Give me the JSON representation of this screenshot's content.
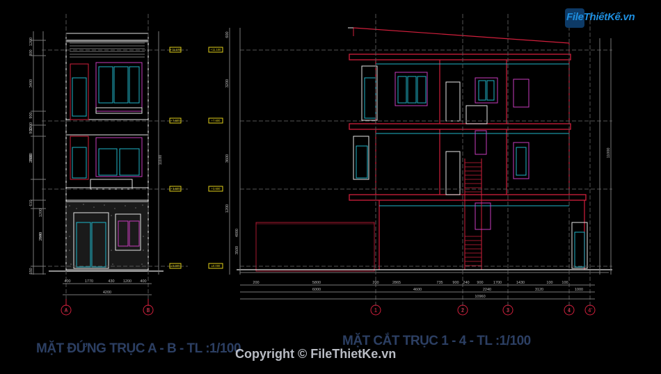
{
  "drawing": {
    "title_left": "MẶT ĐỨNG TRỤC A - B - TL :1/100",
    "title_right": "MẶT CẮT TRỤC 1 - 4 - TL :1/100",
    "copyright": "Copyright © FileThietKe.vn",
    "logo": "FileThiếtKế.vn"
  },
  "left_elevation": {
    "width_dims": [
      "400",
      "1770",
      "430",
      "1200",
      "400"
    ],
    "total_width": "4200",
    "vertical_dims": [
      "1200",
      "800",
      "3400",
      "900",
      "2800",
      "1300",
      "900",
      "2600",
      "610",
      "1200",
      "2800",
      "2940",
      "550"
    ],
    "total_height": "11100",
    "axes": [
      "A",
      "B"
    ],
    "level_marks": [
      "+11.100",
      "+7.600",
      "+3.600",
      "±0.000"
    ]
  },
  "right_section": {
    "bottom_dims_row1": [
      "200",
      "5800",
      "200",
      "2865",
      "735",
      "900",
      "240",
      "900",
      "1700",
      "1430",
      "100",
      "100"
    ],
    "bottom_dims_row2": [
      "6000",
      "4600",
      "2240",
      "3120",
      "1000"
    ],
    "total_length": "10960",
    "axes": [
      "1",
      "2",
      "3",
      "4",
      "4'"
    ],
    "vertical_dims": [
      "600",
      "3200",
      "3600",
      "1200",
      "4000",
      "3500"
    ],
    "total_height": "11000",
    "level_marks": [
      "+11.100",
      "+7.600",
      "+3.600",
      "±0.000"
    ]
  },
  "colors": {
    "background": "#000000",
    "line_white": "#e6e6e6",
    "line_red": "#d21f3c",
    "line_cyan": "#1fb5c9",
    "line_magenta": "#c83cbe",
    "line_yellow": "#e3d21a",
    "line_gray": "#7a7a7a",
    "title_color": "#2c3f63"
  }
}
